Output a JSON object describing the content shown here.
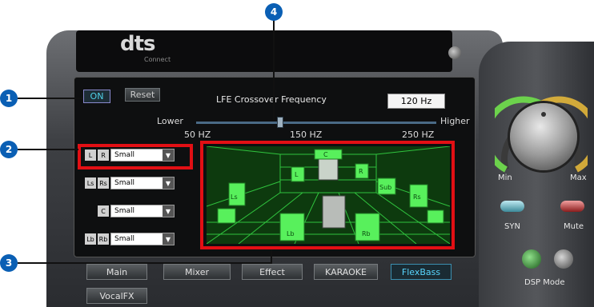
{
  "header": {
    "logo": "dts",
    "logo_sub": "Connect"
  },
  "controls": {
    "on_label": "ON",
    "reset_label": "Reset"
  },
  "lfe": {
    "label": "LFE Crossover Frequency",
    "value": "120 Hz",
    "lower": "Lower",
    "higher": "Higher",
    "tick_50": "50 HZ",
    "tick_150": "150 HZ",
    "tick_250": "250 HZ",
    "slider_fraction": 0.35
  },
  "speakers": [
    {
      "tags": [
        "L",
        "R"
      ],
      "size": "Small"
    },
    {
      "tags": [
        "Ls",
        "Rs"
      ],
      "size": "Small"
    },
    {
      "tags": [
        "C"
      ],
      "size": "Small"
    },
    {
      "tags": [
        "Lb",
        "Rb"
      ],
      "size": "Small"
    }
  ],
  "room": {
    "labels": [
      "C",
      "L",
      "R",
      "Sub",
      "Ls",
      "Rs",
      "Lb",
      "Rb"
    ]
  },
  "tabs": [
    "Main",
    "Mixer",
    "Effect",
    "KARAOKE",
    "FlexBass",
    "VocalFX"
  ],
  "side": {
    "min": "Min",
    "max": "Max",
    "syn": "SYN",
    "mute": "Mute",
    "dsp_mode": "DSP Mode"
  },
  "callouts": [
    "1",
    "2",
    "3",
    "4"
  ],
  "colors": {
    "callout": "#0a5fb4",
    "highlight": "#e20f14",
    "grid": "#39e64a"
  }
}
